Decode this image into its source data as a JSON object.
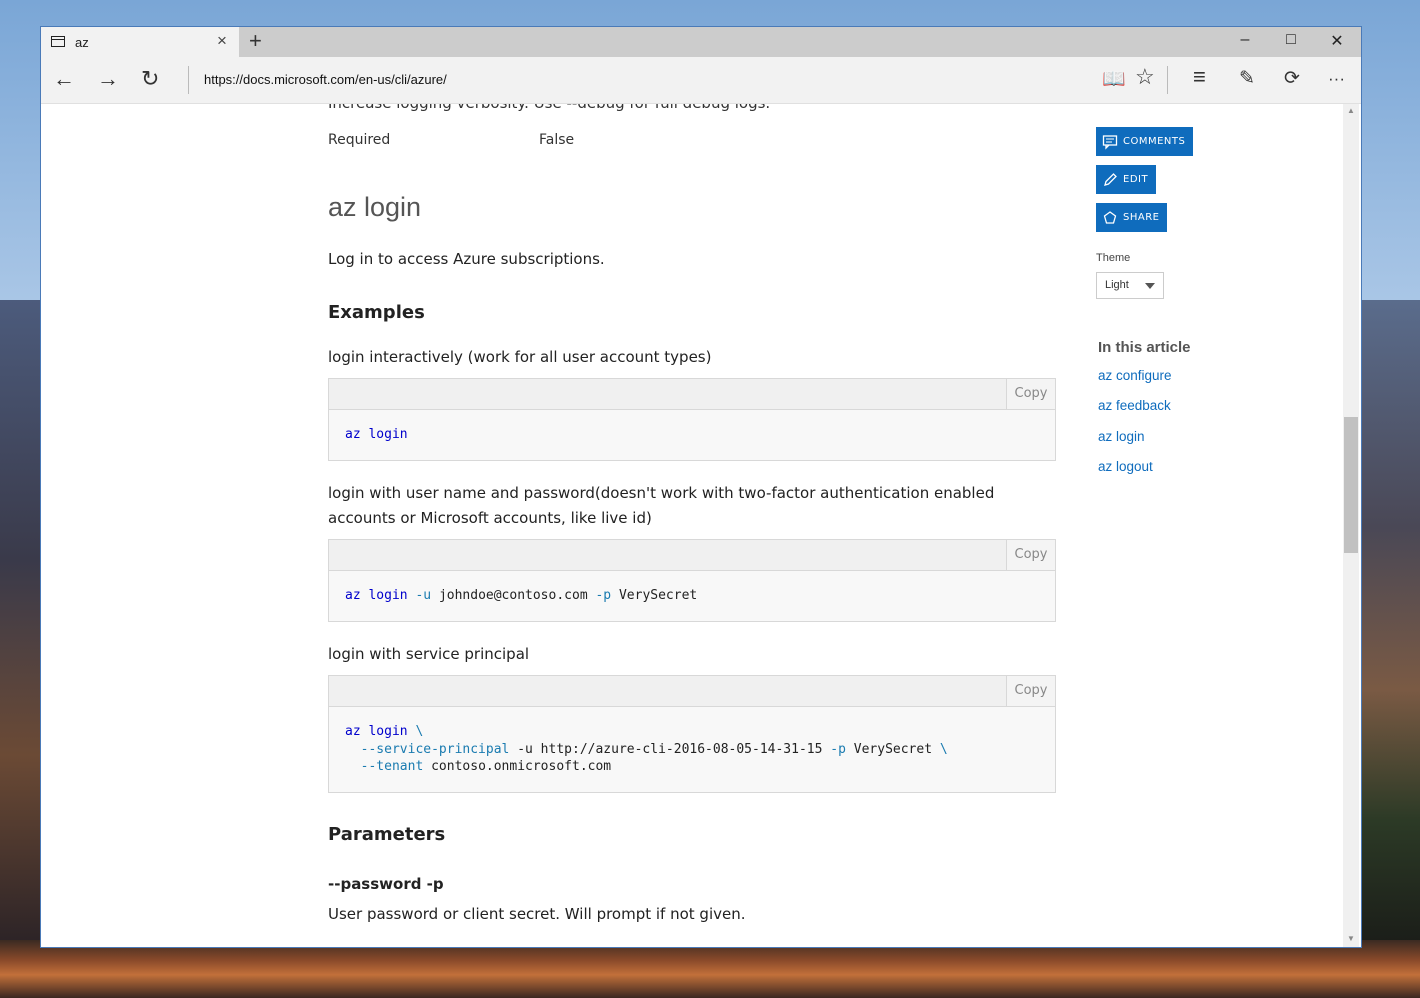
{
  "browser": {
    "tab_title": "az",
    "tab_close": "×",
    "new_tab": "+",
    "window_controls": {
      "minimize": "–",
      "maximize": "□",
      "close": "✕"
    },
    "nav": {
      "back": "←",
      "forward": "→",
      "refresh": "↻"
    },
    "url": "https://docs.microsoft.com/en-us/cli/azure/",
    "tools": {
      "reading_view": "📖",
      "favorite": "☆",
      "hub": "≡",
      "notes": "✎",
      "share": "⟳",
      "more": "···"
    }
  },
  "page": {
    "cut_text": "Increase logging verbosity. Use --debug for full debug logs.",
    "required_label": "Required",
    "required_value": "False",
    "heading": "az login",
    "description": "Log in to access Azure subscriptions.",
    "examples_heading": "Examples",
    "example1_desc": "login interactively (work for all user account types)",
    "example2_desc": "login with user name and password(doesn't work with two-factor authentication enabled accounts or Microsoft accounts, like live id)",
    "example3_desc": "login with service principal",
    "copy_label": "Copy",
    "parameters_heading": "Parameters",
    "param_name": "--password -p",
    "param_desc": "User password or client secret. Will prompt if not given."
  },
  "code": {
    "ex1": {
      "cmd": "az",
      "sub": "login"
    },
    "ex2": {
      "cmd": "az",
      "sub": "login",
      "flag_u": "-u",
      "user": "johndoe@contoso.com",
      "flag_p": "-p",
      "pass": "VerySecret"
    },
    "ex3": {
      "cmd": "az",
      "sub": "login",
      "cont1": "\\",
      "flag_sp": "--service-principal",
      "u_text": "-u http://azure-cli-2016-08-05-14-31-15",
      "flag_p": "-p",
      "pass": "VerySecret",
      "cont2": "\\",
      "flag_tenant": "--tenant",
      "tenant": "contoso.onmicrosoft.com"
    }
  },
  "sidebar": {
    "comments": "COMMENTS",
    "edit": "EDIT",
    "share": "SHARE",
    "theme_label": "Theme",
    "theme_value": "Light",
    "toc_title": "In this article",
    "toc": [
      "az configure",
      "az feedback",
      "az login",
      "az logout"
    ]
  },
  "colors": {
    "accent": "#0f6cbd",
    "code_keyword": "#0000cc",
    "code_param": "#1a7bb0"
  }
}
